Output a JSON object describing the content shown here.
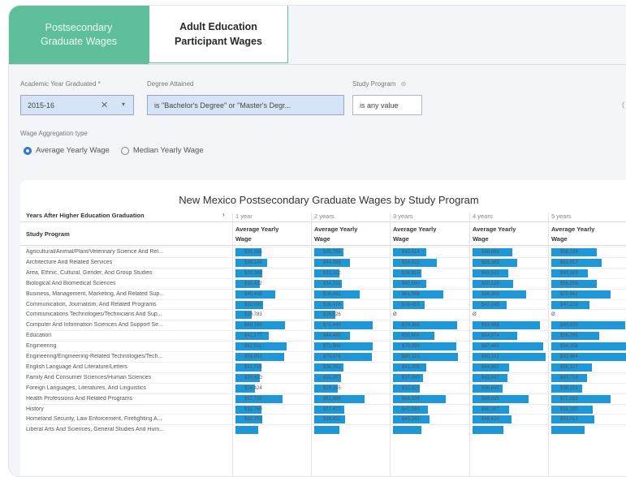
{
  "tabs": [
    {
      "label_line1": "Postsecondary",
      "label_line2": "Graduate Wages",
      "active": true
    },
    {
      "label_line1": "Adult Education",
      "label_line2": "Participant Wages",
      "active": false
    }
  ],
  "filters": {
    "academic_year": {
      "label": "Academic Year Graduated *",
      "value": "2015-16",
      "clear_icon": "close-icon",
      "dropdown_icon": "chevron-down-icon"
    },
    "degree": {
      "label": "Degree Attained",
      "value": "is \"Bachelor's Degree\" or \"Master's Degr..."
    },
    "study_program": {
      "label": "Study Program",
      "value": "is any value"
    },
    "wage_aggregation": {
      "label": "Wage Aggregation type",
      "options": [
        "Average Yearly Wage",
        "Median Yearly Wage"
      ],
      "selected": "Average Yearly Wage"
    }
  },
  "table": {
    "title": "New Mexico Postsecondary Graduate Wages by Study Program",
    "pivot_label": "Years After Higher Education Graduation",
    "row_header": "Study Program",
    "measure_line1": "Average Yearly",
    "measure_line2": "Wage",
    "columns": [
      "1 year",
      "2 years",
      "3 years",
      "4 years",
      "5 years"
    ],
    "bar_color": "#1f97d6",
    "scale_max": 100000,
    "rows": [
      {
        "program": "Agricultural/Animal/Plant/Veterinary Science And Rel...",
        "wages": [
          31556,
          35755,
          40514,
          48666,
          56199
        ],
        "labels": [
          "$31,556",
          "$35,755",
          "$40,514",
          "$48,666",
          "$56,199"
        ]
      },
      {
        "program": "Architecture And Related Services",
        "wages": [
          39149,
          44099,
          54021,
          55369,
          61917
        ],
        "labels": [
          "$39,149",
          "$44,099",
          "$54,021",
          "$55,369",
          "$61,917"
        ]
      },
      {
        "program": "Area, Ethnic, Cultural, Gender, And Group Studies",
        "wages": [
          33368,
          31312,
          34619,
          43510,
          45169
        ],
        "labels": [
          "$33,368",
          "$31,312",
          "$34,619",
          "$43,510",
          "$45,169"
        ]
      },
      {
        "program": "Biological And Biomedical Sciences",
        "wages": [
          30432,
          34311,
          40690,
          50128,
          56256
        ],
        "labels": [
          "$30,432",
          "$34,311",
          "$40,690",
          "$50,128",
          "$56,256"
        ]
      },
      {
        "program": "Business, Management, Marketing, And Related Sup...",
        "wages": [
          49468,
          56462,
          61598,
          66306,
          72662
        ],
        "labels": [
          "$49,468",
          "$56,462",
          "$61,598",
          "$66,306",
          "$72,662"
        ]
      },
      {
        "program": "Communication, Journalism, And Related Programs",
        "wages": [
          33899,
          36476,
          39419,
          42248,
          47223
        ],
        "labels": [
          "$33,899",
          "$36,476",
          "$39,419",
          "$42,248",
          "$47,223"
        ]
      },
      {
        "program": "Communications Technologies/Technicians And Sup...",
        "wages": [
          19783,
          25626,
          0,
          0,
          0
        ],
        "labels": [
          "$19,783",
          "$25,626",
          "Ø",
          "Ø",
          "Ø"
        ]
      },
      {
        "program": "Computer And Information Sciences And Support Se...",
        "wages": [
          60789,
          72440,
          79368,
          83489,
          90839
        ],
        "labels": [
          "$60,789",
          "$72,440",
          "$79,368",
          "$83,489",
          "$90,839"
        ]
      },
      {
        "program": "Education",
        "wages": [
          41177,
          44485,
          50605,
          54974,
          59295
        ],
        "labels": [
          "$41,177",
          "$44,485",
          "$50,605",
          "$54,974",
          "$59,295"
        ]
      },
      {
        "program": "Engineering",
        "wages": [
          62511,
          71569,
          78393,
          87460,
          94258
        ],
        "labels": [
          "$62,511",
          "$71,569",
          "$78,393",
          "$87,460",
          "$94,258"
        ]
      },
      {
        "program": "Engineering/Engineering-Related Technologies/Tech...",
        "wages": [
          59853,
          70976,
          80321,
          90161,
          92964
        ],
        "labels": [
          "$59,853",
          "$70,976",
          "$80,321",
          "$90,161",
          "$92,964"
        ]
      },
      {
        "program": "English Language And Literature/Letters",
        "wages": [
          31728,
          36352,
          41305,
          44862,
          50327
        ],
        "labels": [
          "$31,728",
          "$36,352",
          "$41,305",
          "$44,862",
          "$50,327"
        ]
      },
      {
        "program": "Family And Consumer Sciences/Human Sciences",
        "wages": [
          29510,
          33207,
          37060,
          43047,
          43718
        ],
        "labels": [
          "$29,510",
          "$33,207",
          "$37,060",
          "$43,047",
          "$43,718"
        ]
      },
      {
        "program": "Foreign Languages, Literatures, And Linguistics",
        "wages": [
          24424,
          29245,
          32825,
          36845,
          38221
        ],
        "labels": [
          "$24,424",
          "$29,245",
          "$32,825",
          "$36,845",
          "$38,221"
        ]
      },
      {
        "program": "Health Professions And Related Programs",
        "wages": [
          57728,
          61696,
          64509,
          69095,
          72859
        ],
        "labels": [
          "$57,728",
          "$61,696",
          "$64,509",
          "$69,095",
          "$72,859"
        ]
      },
      {
        "program": "History",
        "wages": [
          31750,
          37477,
          42584,
          45387,
          51330
        ],
        "labels": [
          "$31,750",
          "$37,477",
          "$42,584",
          "$45,387",
          "$51,330"
        ]
      },
      {
        "program": "Homeland Security, Law Enforcement, Firefighting A...",
        "wages": [
          32783,
          38431,
          45283,
          48422,
          53012
        ],
        "labels": [
          "$32,783",
          "$38,431",
          "$45,283",
          "$48,422",
          "$53,012"
        ]
      },
      {
        "program": "Liberal Arts And Sciences, General Studies And Hum...",
        "wages": [
          28000,
          31000,
          35000,
          38000,
          41000
        ],
        "labels": [
          "",
          "",
          "",
          "",
          ""
        ]
      }
    ]
  }
}
